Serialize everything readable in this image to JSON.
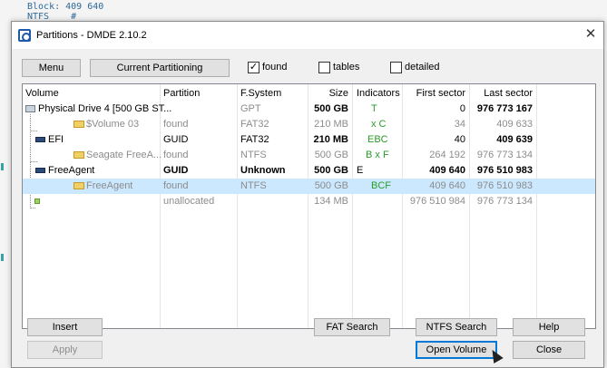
{
  "background": {
    "line1": "Block: 409 640",
    "line2": "NTFS    #"
  },
  "window": {
    "title": "Partitions - DMDE 2.10.2",
    "close_glyph": "✕"
  },
  "toolbar": {
    "menu_label": "Menu",
    "current_partitioning_label": "Current Partitioning"
  },
  "options": {
    "found": {
      "label": "found",
      "checked": true
    },
    "tables": {
      "label": "tables",
      "checked": false
    },
    "detailed": {
      "label": "detailed",
      "checked": false
    }
  },
  "table": {
    "headers": {
      "volume": "Volume",
      "partition": "Partition",
      "fsystem": "F.System",
      "size": "Size",
      "indicators": "Indicators",
      "first_sector": "First sector",
      "last_sector": "Last sector"
    },
    "rows": [
      {
        "volume": "Physical Drive 4 [500 GB ST...",
        "partition": "",
        "fs": "GPT",
        "size": "500 GB",
        "ind": "T",
        "first": "0",
        "last": "976 773 167"
      },
      {
        "volume": "$Volume 03",
        "partition": "found",
        "fs": "FAT32",
        "size": "210 MB",
        "ind": "x C",
        "first": "34",
        "last": "409 633"
      },
      {
        "volume": "EFI",
        "partition": "GUID",
        "fs": "FAT32",
        "size": "210 MB",
        "ind": "EBC",
        "first": "40",
        "last": "409 639"
      },
      {
        "volume": "Seagate FreeA...",
        "partition": "found",
        "fs": "NTFS",
        "size": "500 GB",
        "ind": "B x F",
        "first": "264 192",
        "last": "976 773 134"
      },
      {
        "volume": "FreeAgent",
        "partition": "GUID",
        "fs": "Unknown",
        "size": "500 GB",
        "ind": "E",
        "first": "409 640",
        "last": "976 510 983"
      },
      {
        "volume": "FreeAgent",
        "partition": "found",
        "fs": "NTFS",
        "size": "500 GB",
        "ind": "BCF",
        "first": "409 640",
        "last": "976 510 983"
      },
      {
        "volume": "",
        "partition": "unallocated",
        "fs": "",
        "size": "134 MB",
        "ind": "",
        "first": "976 510 984",
        "last": "976 773 134"
      }
    ]
  },
  "buttons": {
    "insert": "Insert",
    "apply": "Apply",
    "fat_search": "FAT Search",
    "ntfs_search": "NTFS Search",
    "open_volume": "Open Volume",
    "help": "Help",
    "close": "Close"
  },
  "colors": {
    "selection": "#cce8ff",
    "indicator_green": "#2a9a2a",
    "focus_blue": "#0078d7"
  }
}
